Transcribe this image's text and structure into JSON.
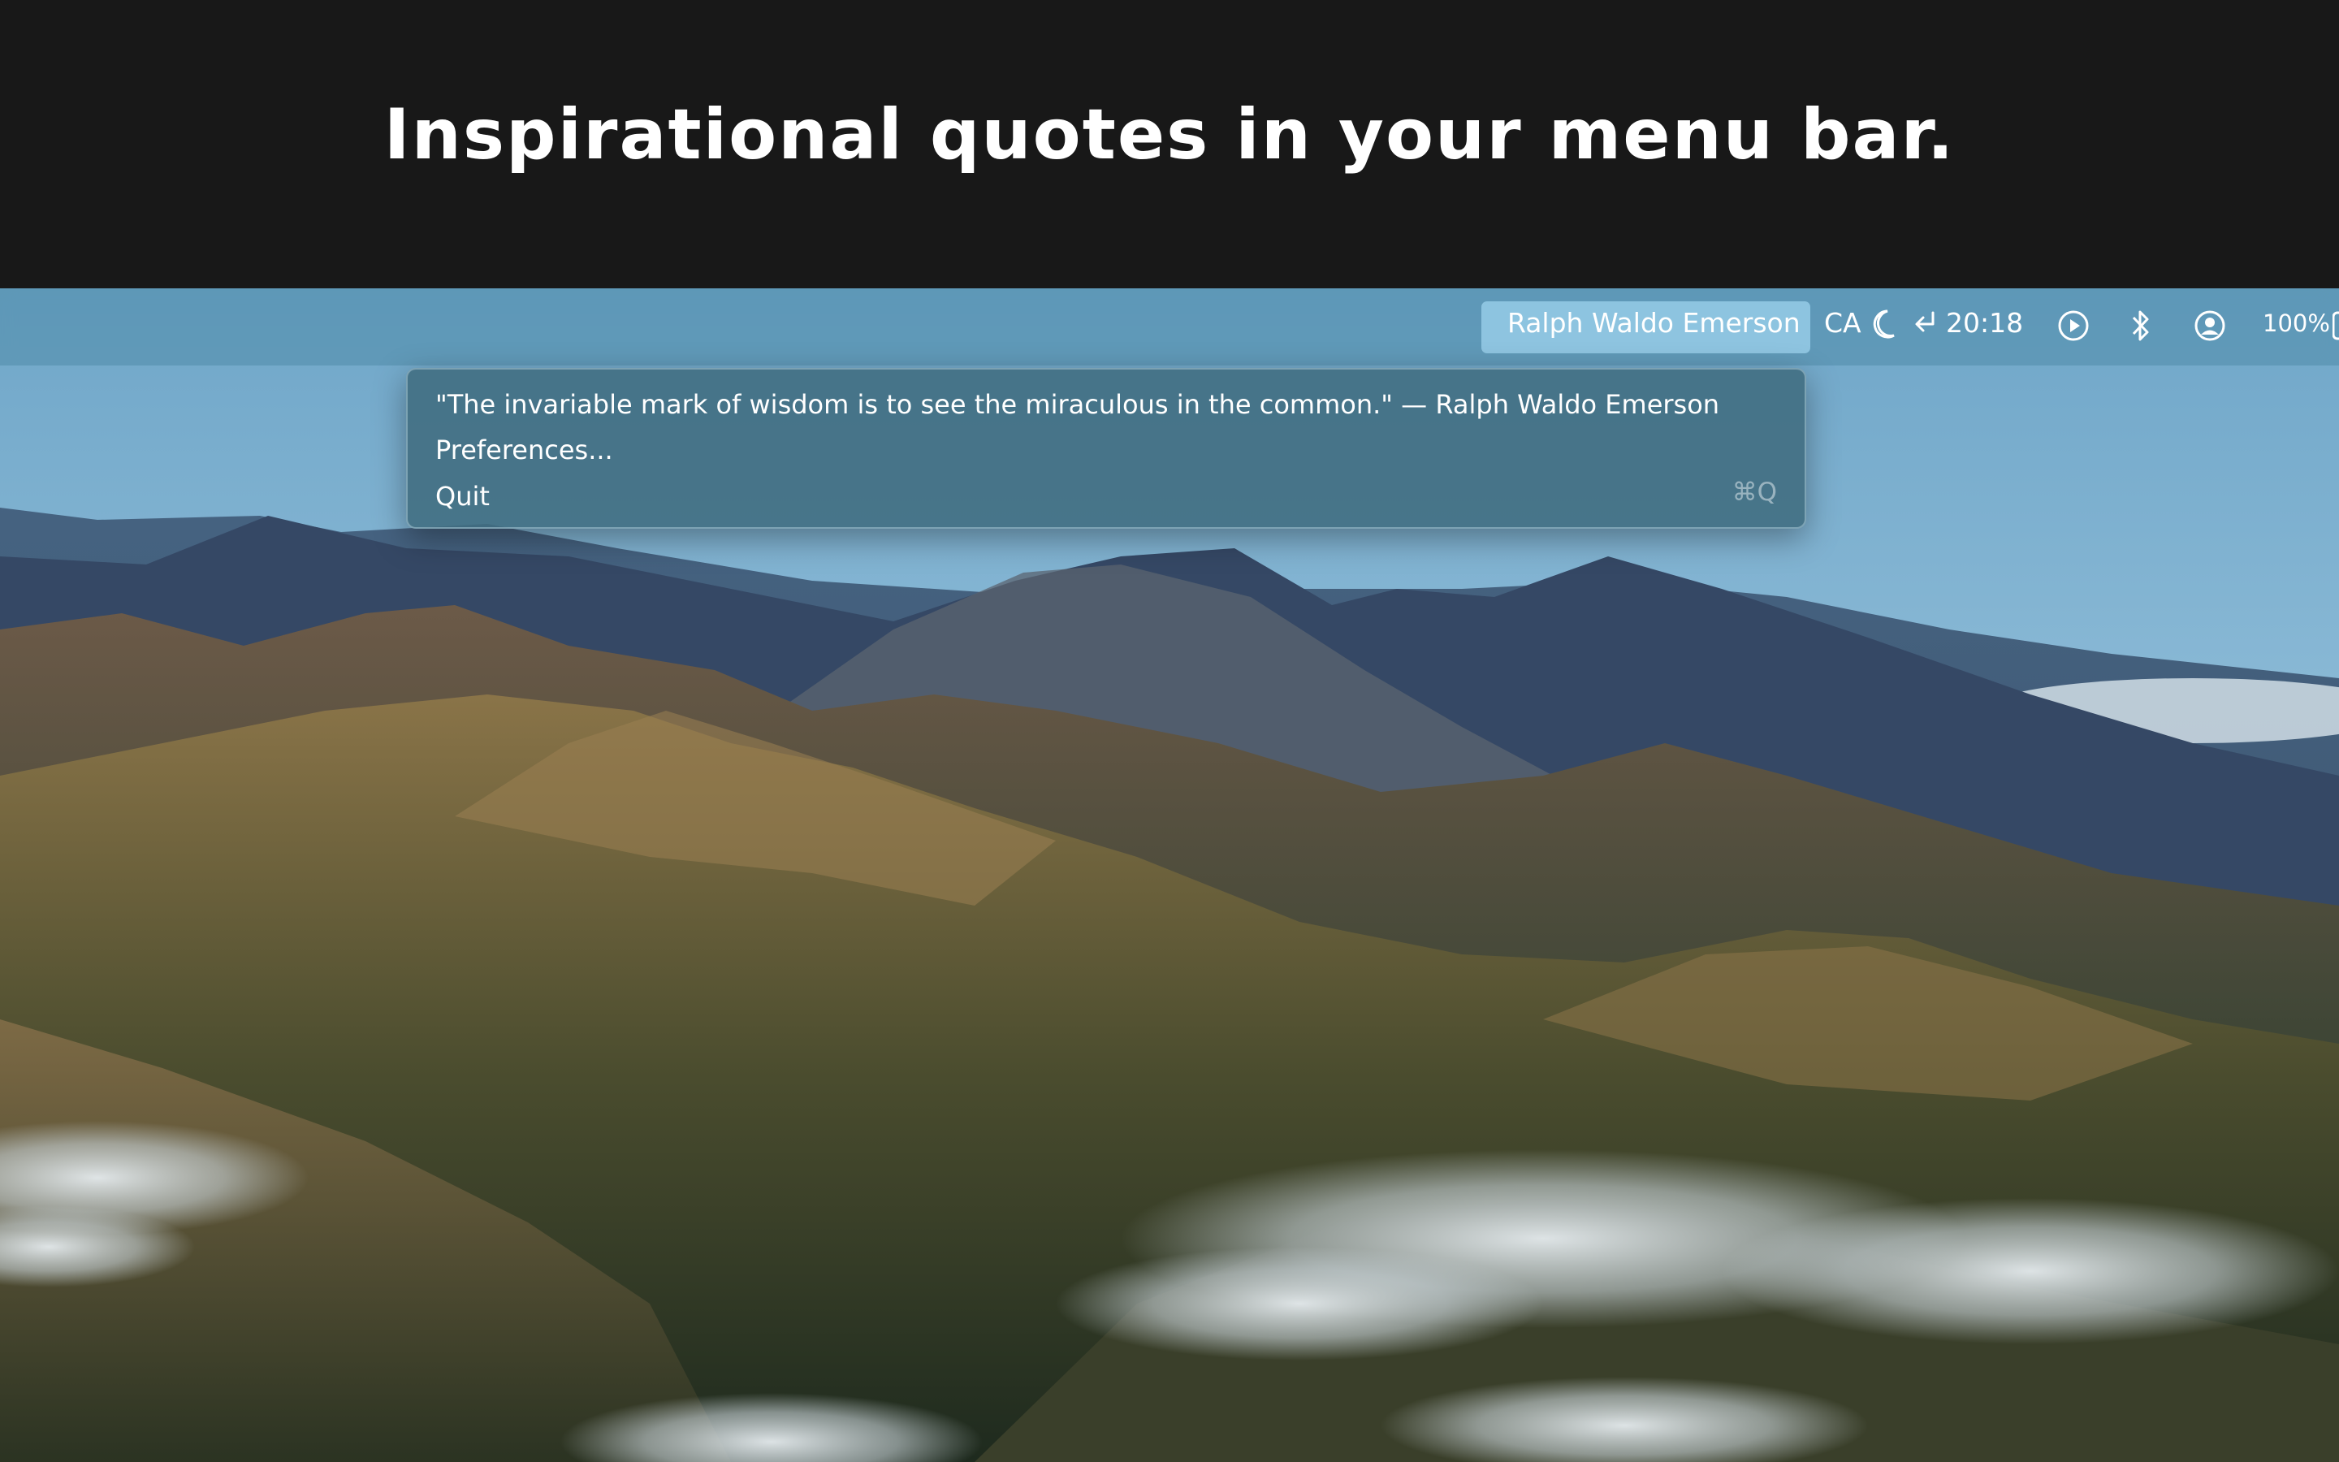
{
  "banner": {
    "headline": "Inspirational quotes in your menu bar."
  },
  "menubar": {
    "active_item": "Ralph Waldo Emerson",
    "input_source": "CA",
    "clock": "20:18",
    "battery": "100%",
    "icons": [
      "moon-icon",
      "return-arrow-icon",
      "play-circle-icon",
      "bluetooth-icon",
      "user-account-icon",
      "battery-icon"
    ]
  },
  "dropdown": {
    "quote": "\"The invariable mark of wisdom is to see the miraculous in the common.\" — Ralph Waldo Emerson",
    "preferences_label": "Preferences...",
    "quit_label": "Quit",
    "quit_shortcut": "⌘Q"
  }
}
